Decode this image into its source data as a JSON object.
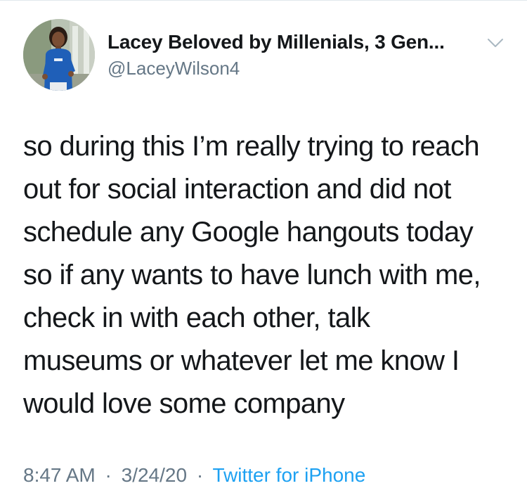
{
  "user": {
    "display_name": "Lacey Beloved by Millenials, 3 Gen...",
    "handle": "@LaceyWilson4",
    "avatar_icon": "profile-photo"
  },
  "menu": {
    "icon": "chevron-down-icon"
  },
  "tweet": {
    "lines": [
      "so during this I’m really trying to reach",
      "out for social interaction and did not",
      "schedule any Google hangouts today",
      "so if any wants to have lunch with me,",
      "check in with each other, talk",
      "museums or whatever let me know I",
      "would love some company"
    ]
  },
  "meta": {
    "time": "8:47 AM",
    "separator": "·",
    "date": "3/24/20",
    "source": "Twitter for iPhone"
  },
  "colors": {
    "text": "#14171a",
    "secondary": "#657786",
    "link": "#1da1f2"
  }
}
